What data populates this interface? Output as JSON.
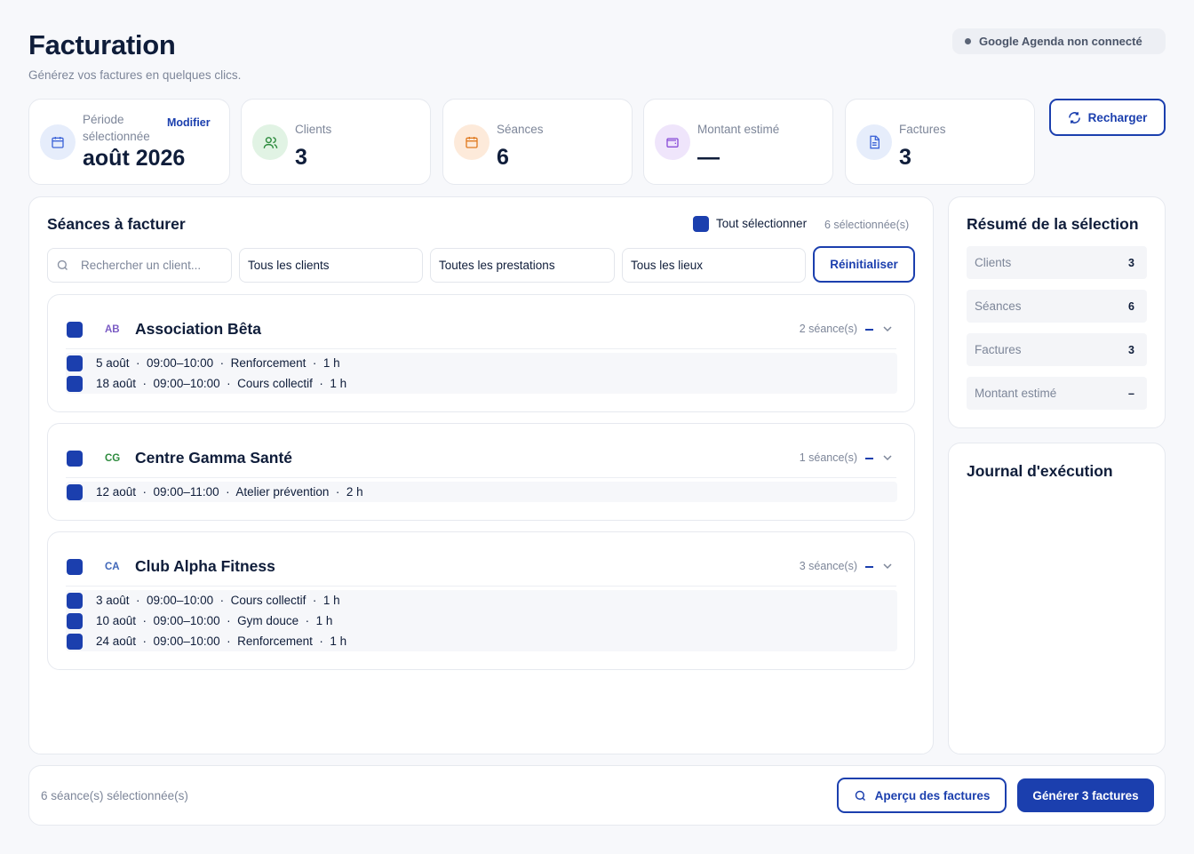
{
  "header": {
    "title": "Facturation",
    "subtitle": "Générez vos factures en quelques clics.",
    "gcal_status": "Google Agenda non connecté"
  },
  "stats": {
    "period": {
      "label": "Période sélectionnée",
      "value": "août 2026",
      "action": "Modifier",
      "icon": "calendar-icon"
    },
    "clients": {
      "label": "Clients",
      "value": "3",
      "icon": "users-icon"
    },
    "seances": {
      "label": "Séances",
      "value": "6",
      "icon": "calendar-icon"
    },
    "montant": {
      "label": "Montant estimé",
      "value": "—",
      "icon": "wallet-icon"
    },
    "factures": {
      "label": "Factures",
      "value": "3",
      "icon": "document-icon"
    }
  },
  "reload_label": "Recharger",
  "sessions_panel": {
    "title": "Séances à facturer",
    "select_all_label": "Tout sélectionner",
    "selected_count": "6 sélectionnée(s)",
    "search_placeholder": "Rechercher un client...",
    "filter_clients": "Tous les clients",
    "filter_prestations": "Toutes les prestations",
    "filter_lieux": "Tous les lieux",
    "reset_label": "Réinitialiser"
  },
  "groups": [
    {
      "abbr": "AB",
      "name": "Association Bêta",
      "count": "2 séance(s)",
      "color": "#7b5cc4",
      "sessions": [
        "5 août  ·  09:00–10:00  ·  Renforcement  ·  1 h",
        "18 août  ·  09:00–10:00  ·  Cours collectif  ·  1 h"
      ]
    },
    {
      "abbr": "CG",
      "name": "Centre Gamma Santé",
      "count": "1 séance(s)",
      "color": "#2e8b3e",
      "sessions": [
        "12 août  ·  09:00–11:00  ·  Atelier prévention  ·  2 h"
      ]
    },
    {
      "abbr": "CA",
      "name": "Club Alpha Fitness",
      "count": "3 séance(s)",
      "color": "#3f66b8",
      "sessions": [
        "3 août  ·  09:00–10:00  ·  Cours collectif  ·  1 h",
        "10 août  ·  09:00–10:00  ·  Gym douce  ·  1 h",
        "24 août  ·  09:00–10:00  ·  Renforcement  ·  1 h"
      ]
    }
  ],
  "summary": {
    "title": "Résumé de la sélection",
    "rows": [
      {
        "label": "Clients",
        "value": "3"
      },
      {
        "label": "Séances",
        "value": "6"
      },
      {
        "label": "Factures",
        "value": "3"
      },
      {
        "label": "Montant estimé",
        "value": "–"
      }
    ]
  },
  "journal": {
    "title": "Journal d'exécution"
  },
  "footer": {
    "selected_text": "6 séance(s) sélectionnée(s)",
    "preview_label": "Aperçu des factures",
    "generate_label": "Générer 3 factures"
  },
  "colors": {
    "accent": "#1b3fae",
    "text": "#0f1d3a",
    "muted": "#7d8699"
  }
}
